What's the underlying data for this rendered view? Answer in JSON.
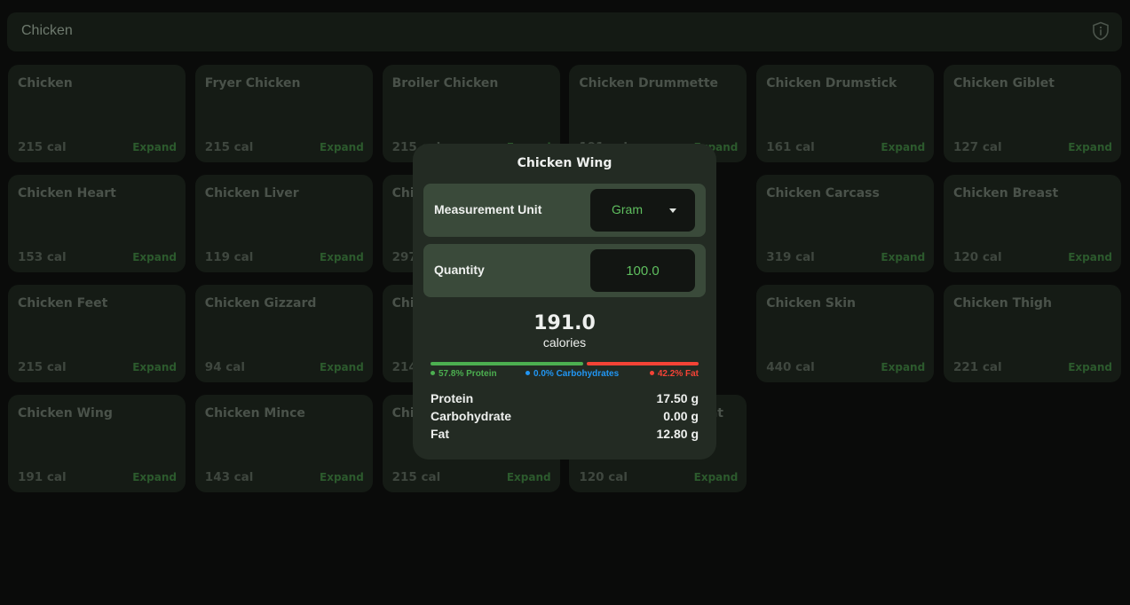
{
  "search": {
    "value": "Chicken"
  },
  "foods": [
    {
      "name": "Chicken",
      "cal": "215 cal"
    },
    {
      "name": "Fryer Chicken",
      "cal": "215 cal"
    },
    {
      "name": "Broiler Chicken",
      "cal": "215 cal"
    },
    {
      "name": "Chicken Drummette",
      "cal": "191 cal"
    },
    {
      "name": "Chicken Drumstick",
      "cal": "161 cal"
    },
    {
      "name": "Chicken Giblet",
      "cal": "127 cal"
    },
    {
      "name": "Chicken Heart",
      "cal": "153 cal"
    },
    {
      "name": "Chicken Liver",
      "cal": "119 cal"
    },
    {
      "name": "Chicken Back",
      "cal": "297 cal"
    },
    {
      "name": "",
      "cal": ""
    },
    {
      "name": "Chicken Carcass",
      "cal": "319 cal"
    },
    {
      "name": "Chicken Breast",
      "cal": "120 cal"
    },
    {
      "name": "Chicken Feet",
      "cal": "215 cal"
    },
    {
      "name": "Chicken Gizzard",
      "cal": "94 cal"
    },
    {
      "name": "Chicken Leg",
      "cal": "214 cal"
    },
    {
      "name": "",
      "cal": ""
    },
    {
      "name": "Chicken Skin",
      "cal": "440 cal"
    },
    {
      "name": "Chicken Thigh",
      "cal": "221 cal"
    },
    {
      "name": "Chicken Wing",
      "cal": "191 cal"
    },
    {
      "name": "Chicken Mince",
      "cal": "143 cal"
    },
    {
      "name": "Chicken Meat",
      "cal": "215 cal"
    },
    {
      "name": "Chicken Breast Meat",
      "cal": "120 cal"
    }
  ],
  "expand_label": "Expand",
  "modal": {
    "title": "Chicken Wing",
    "unit_label": "Measurement Unit",
    "unit_value": "Gram",
    "quantity_label": "Quantity",
    "quantity_value": "100.0",
    "calories": "191.0",
    "calories_label": "calories",
    "legend": {
      "protein": "57.8% Protein",
      "carbs": "0.0% Carbohydrates",
      "fat": "42.2% Fat"
    },
    "split": {
      "protein": 0.578,
      "carbs": 0.0,
      "fat": 0.422
    },
    "macros": [
      {
        "name": "Protein",
        "value": "17.50 g"
      },
      {
        "name": "Carbohydrate",
        "value": "0.00 g"
      },
      {
        "name": "Fat",
        "value": "12.80 g"
      }
    ]
  },
  "colors": {
    "protein": "#4caf50",
    "carbs": "#2196f3",
    "fat": "#f44336"
  },
  "icons": {
    "info": "shield-info-icon",
    "dropdown": "caret-down-icon"
  }
}
